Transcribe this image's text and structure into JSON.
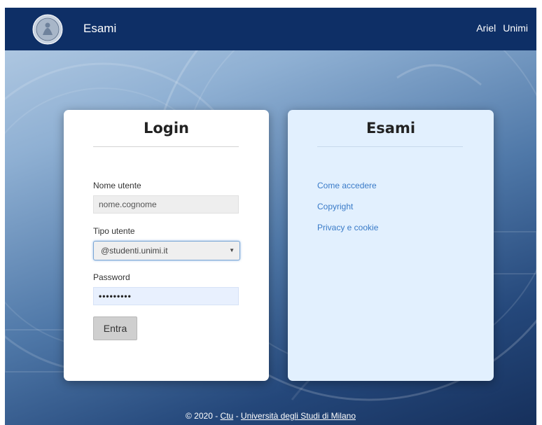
{
  "navbar": {
    "brand": "Esami",
    "links": [
      "Ariel",
      "Unimi"
    ]
  },
  "login": {
    "title": "Login",
    "username_label": "Nome utente",
    "username_placeholder": "nome.cognome",
    "user_type_label": "Tipo utente",
    "user_type_selected": "@studenti.unimi.it",
    "password_label": "Password",
    "password_value": "•••••••••",
    "submit_label": "Entra"
  },
  "info": {
    "title": "Esami",
    "links": [
      "Come accedere",
      "Copyright",
      "Privacy e cookie"
    ]
  },
  "footer": {
    "prefix": "© 2020 - ",
    "link1": "Ctu",
    "separator": " - ",
    "link2": "Università degli Studi di Milano"
  },
  "colors": {
    "navbar": "#0e2f66",
    "info_card": "#e2f0fe",
    "link": "#3a7bc8",
    "button": "#cfcfcf"
  }
}
